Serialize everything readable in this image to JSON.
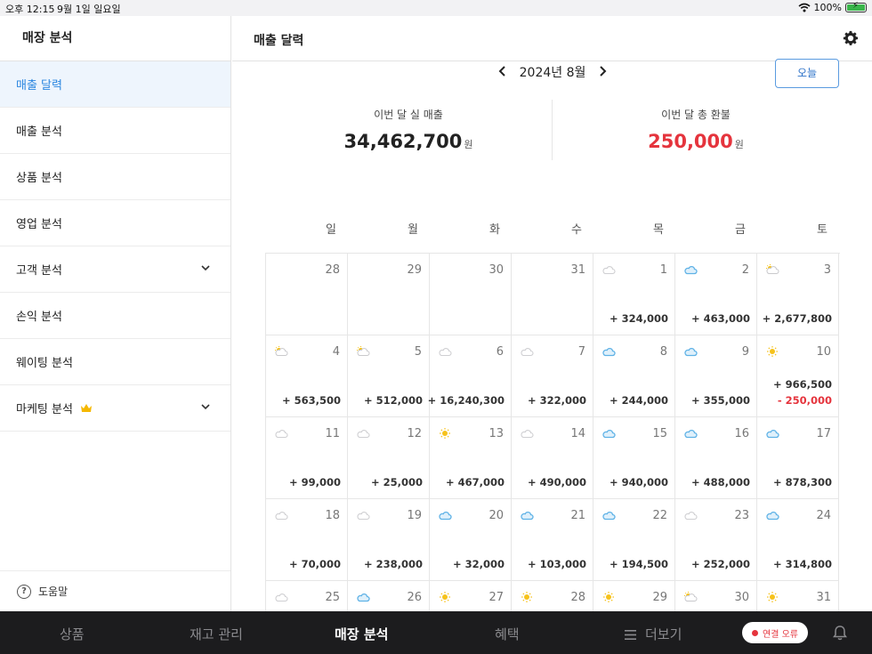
{
  "status_bar": {
    "time": "오후 12:15",
    "date": "9월 1일 일요일",
    "battery": "100%"
  },
  "sidebar": {
    "title": "매장 분석",
    "items": [
      {
        "label": "매출 달력",
        "active": true
      },
      {
        "label": "매출 분석"
      },
      {
        "label": "상품 분석"
      },
      {
        "label": "영업 분석"
      },
      {
        "label": "고객 분석",
        "expandable": true
      },
      {
        "label": "손익 분석"
      },
      {
        "label": "웨이팅 분석"
      },
      {
        "label": "마케팅 분석",
        "expandable": true,
        "premium": true
      }
    ],
    "help_label": "도움말",
    "help_icon_glyph": "?"
  },
  "header": {
    "title": "매출 달력"
  },
  "calendar_nav": {
    "month_label": "2024년 8월",
    "today_button": "오늘"
  },
  "summary": {
    "net_sales_label": "이번 달 실 매출",
    "net_sales_value": "34,462,700",
    "net_sales_unit": "원",
    "refund_label": "이번 달 총 환불",
    "refund_value": "250,000",
    "refund_unit": "원"
  },
  "weekdays": [
    "일",
    "월",
    "화",
    "수",
    "목",
    "금",
    "토"
  ],
  "weeks": [
    [
      {
        "day": "28",
        "weather": null,
        "amount": null
      },
      {
        "day": "29",
        "weather": null,
        "amount": null
      },
      {
        "day": "30",
        "weather": null,
        "amount": null
      },
      {
        "day": "31",
        "weather": null,
        "amount": null
      },
      {
        "day": "1",
        "weather": "cloud-gray",
        "amount": "+ 324,000"
      },
      {
        "day": "2",
        "weather": "cloud-blue",
        "amount": "+ 463,000"
      },
      {
        "day": "3",
        "weather": "sun-cloud",
        "amount": "+ 2,677,800"
      }
    ],
    [
      {
        "day": "4",
        "weather": "sun-cloud",
        "amount": "+ 563,500"
      },
      {
        "day": "5",
        "weather": "sun-cloud",
        "amount": "+ 512,000"
      },
      {
        "day": "6",
        "weather": "cloud-gray",
        "amount": "+ 16,240,300"
      },
      {
        "day": "7",
        "weather": "cloud-gray",
        "amount": "+ 322,000"
      },
      {
        "day": "8",
        "weather": "cloud-blue",
        "amount": "+ 244,000"
      },
      {
        "day": "9",
        "weather": "cloud-blue",
        "amount": "+ 355,000"
      },
      {
        "day": "10",
        "weather": "sun",
        "amount": "+ 966,500",
        "refund": "- 250,000"
      }
    ],
    [
      {
        "day": "11",
        "weather": "cloud-gray",
        "amount": "+ 99,000"
      },
      {
        "day": "12",
        "weather": "cloud-gray",
        "amount": "+ 25,000"
      },
      {
        "day": "13",
        "weather": "sun",
        "amount": "+ 467,000"
      },
      {
        "day": "14",
        "weather": "cloud-gray",
        "amount": "+ 490,000"
      },
      {
        "day": "15",
        "weather": "cloud-blue",
        "amount": "+ 940,000"
      },
      {
        "day": "16",
        "weather": "cloud-blue",
        "amount": "+ 488,000"
      },
      {
        "day": "17",
        "weather": "cloud-blue",
        "amount": "+ 878,300"
      }
    ],
    [
      {
        "day": "18",
        "weather": "cloud-gray",
        "amount": "+ 70,000"
      },
      {
        "day": "19",
        "weather": "cloud-gray",
        "amount": "+ 238,000"
      },
      {
        "day": "20",
        "weather": "cloud-blue",
        "amount": "+ 32,000"
      },
      {
        "day": "21",
        "weather": "cloud-blue",
        "amount": "+ 103,000"
      },
      {
        "day": "22",
        "weather": "cloud-blue",
        "amount": "+ 194,500"
      },
      {
        "day": "23",
        "weather": "cloud-gray",
        "amount": "+ 252,000"
      },
      {
        "day": "24",
        "weather": "cloud-blue",
        "amount": "+ 314,800"
      }
    ],
    [
      {
        "day": "25",
        "weather": "cloud-gray",
        "amount": null
      },
      {
        "day": "26",
        "weather": "cloud-blue",
        "amount": null
      },
      {
        "day": "27",
        "weather": "sun",
        "amount": null
      },
      {
        "day": "28",
        "weather": "sun",
        "amount": null
      },
      {
        "day": "29",
        "weather": "sun",
        "amount": null
      },
      {
        "day": "30",
        "weather": "sun-cloud",
        "amount": null
      },
      {
        "day": "31",
        "weather": "sun",
        "amount": null
      }
    ]
  ],
  "tabbar": {
    "tabs": [
      {
        "label": "상품"
      },
      {
        "label": "재고 관리"
      },
      {
        "label": "매장 분석",
        "active": true
      },
      {
        "label": "혜택"
      },
      {
        "label": "더보기"
      }
    ],
    "connection_status": "연결 오류"
  },
  "colors": {
    "accent": "#2a86e0",
    "refund_red": "#e5343d",
    "tabbar_bg": "#1c1c1e"
  }
}
